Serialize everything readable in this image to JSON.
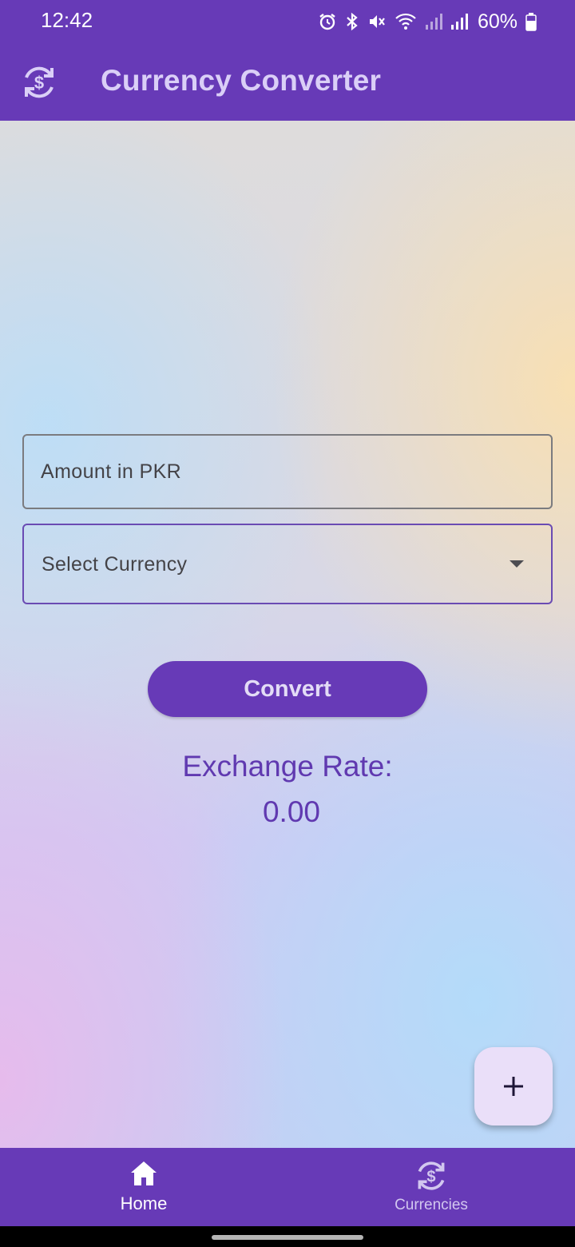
{
  "status_bar": {
    "time": "12:42",
    "battery": "60%",
    "icons": [
      "alarm-icon",
      "bluetooth-icon",
      "mute-icon",
      "wifi-icon",
      "signal-icon",
      "signal-icon",
      "battery-icon"
    ]
  },
  "app_bar": {
    "title": "Currency Converter",
    "logo_icon": "currency-exchange-icon"
  },
  "form": {
    "amount_placeholder": "Amount in PKR",
    "currency_label": "Select Currency",
    "convert_label": "Convert"
  },
  "result": {
    "label": "Exchange Rate:",
    "value": "0.00"
  },
  "fab": {
    "icon": "plus-icon"
  },
  "bottom_nav": {
    "items": [
      {
        "label": "Home",
        "icon": "home-icon",
        "selected": true
      },
      {
        "label": "Currencies",
        "icon": "currency-exchange-icon",
        "selected": false
      }
    ]
  },
  "colors": {
    "primary": "#673ab7",
    "on_primary_title": "#dacff7",
    "result_text": "#6039b0",
    "fab_bg": "#eadff9"
  }
}
